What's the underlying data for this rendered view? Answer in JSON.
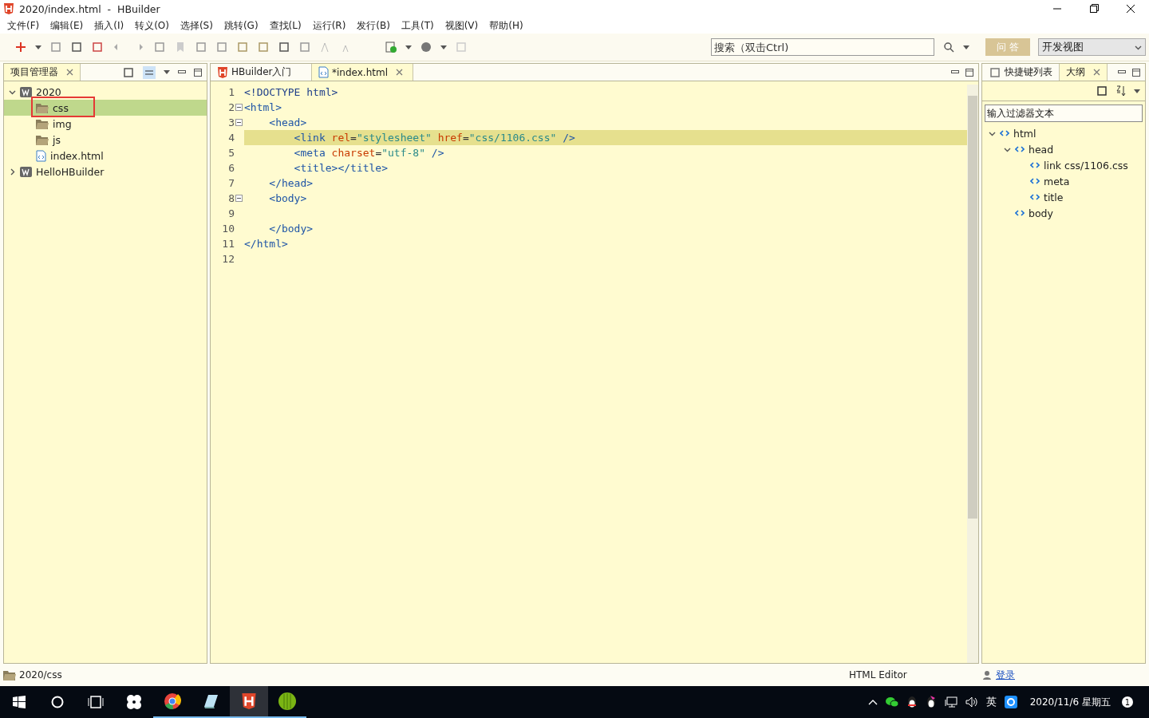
{
  "window": {
    "title": "2020/index.html  -  HBuilder"
  },
  "menu": [
    "文件(F)",
    "编辑(E)",
    "插入(I)",
    "转义(O)",
    "选择(S)",
    "跳转(G)",
    "查找(L)",
    "运行(R)",
    "发行(B)",
    "工具(T)",
    "视图(V)",
    "帮助(H)"
  ],
  "toolbar": {
    "search": {
      "placeholder": "搜索（双击Ctrl)"
    },
    "qa_button": "问 答",
    "perspective": "开发视图"
  },
  "project_panel": {
    "tab": "项目管理器",
    "tree": [
      {
        "label": "2020",
        "kind": "project",
        "expanded": true,
        "selected": false,
        "children": [
          {
            "label": "css",
            "kind": "folder",
            "selected": true
          },
          {
            "label": "img",
            "kind": "folder",
            "selected": false
          },
          {
            "label": "js",
            "kind": "folder",
            "selected": false
          },
          {
            "label": "index.html",
            "kind": "file",
            "selected": false
          }
        ]
      },
      {
        "label": "HelloHBuilder",
        "kind": "project",
        "expanded": false,
        "selected": false
      }
    ]
  },
  "editor": {
    "tabs": [
      {
        "label": "HBuilder入门",
        "kind": "app",
        "selected": false
      },
      {
        "label": "*index.html",
        "kind": "file",
        "selected": true
      }
    ],
    "lines": [
      {
        "number": "1",
        "fold": false,
        "current": false,
        "tokens": [
          {
            "kind": "doctype",
            "text": "<!DOCTYPE html>"
          }
        ]
      },
      {
        "number": "2",
        "fold": true,
        "current": false,
        "tokens": [
          {
            "kind": "tag",
            "text": "<html>"
          }
        ]
      },
      {
        "number": "3",
        "fold": true,
        "current": false,
        "tokens": [
          {
            "kind": "tag",
            "text": "    <head>"
          }
        ]
      },
      {
        "number": "4",
        "fold": false,
        "current": true,
        "tokens": [
          {
            "kind": "tag",
            "text": "        <link "
          },
          {
            "kind": "attr",
            "text": "rel"
          },
          {
            "kind": "plain",
            "text": "="
          },
          {
            "kind": "string",
            "text": "\"stylesheet\" "
          },
          {
            "kind": "attr",
            "text": "href"
          },
          {
            "kind": "plain",
            "text": "="
          },
          {
            "kind": "string",
            "text": "\"css/1106.css\" "
          },
          {
            "kind": "tag",
            "text": "/>"
          }
        ]
      },
      {
        "number": "5",
        "fold": false,
        "current": false,
        "tokens": [
          {
            "kind": "tag",
            "text": "        <meta "
          },
          {
            "kind": "attr",
            "text": "charset"
          },
          {
            "kind": "plain",
            "text": "="
          },
          {
            "kind": "string",
            "text": "\"utf-8\" "
          },
          {
            "kind": "tag",
            "text": "/>"
          }
        ]
      },
      {
        "number": "6",
        "fold": false,
        "current": false,
        "tokens": [
          {
            "kind": "tag",
            "text": "        <title></title>"
          }
        ]
      },
      {
        "number": "7",
        "fold": false,
        "current": false,
        "tokens": [
          {
            "kind": "tag",
            "text": "    </head>"
          }
        ]
      },
      {
        "number": "8",
        "fold": true,
        "current": false,
        "tokens": [
          {
            "kind": "tag",
            "text": "    <body>"
          }
        ]
      },
      {
        "number": "9",
        "fold": false,
        "current": false
      },
      {
        "number": "10",
        "fold": false,
        "current": false,
        "tokens": [
          {
            "kind": "tag",
            "text": "    </body>"
          }
        ]
      },
      {
        "number": "11",
        "fold": false,
        "current": false,
        "tokens": [
          {
            "kind": "tag",
            "text": "</html>"
          }
        ]
      },
      {
        "number": "12",
        "fold": false,
        "current": false
      }
    ]
  },
  "outline_panel": {
    "tabs": [
      {
        "label": "快捷键列表",
        "selected": false
      },
      {
        "label": "大纲",
        "selected": true
      }
    ],
    "filter": {
      "placeholder": "输入过滤器文本"
    },
    "tree": [
      {
        "label": "html",
        "expanded": true,
        "children": [
          {
            "label": "head",
            "expanded": true,
            "children": [
              {
                "label": "link css/1106.css"
              },
              {
                "label": "meta"
              },
              {
                "label": "title"
              }
            ]
          },
          {
            "label": "body"
          }
        ]
      }
    ]
  },
  "status_bar": {
    "path": "2020/css",
    "editor_type": "HTML Editor",
    "login": "登录"
  },
  "taskbar": {
    "ime": "英",
    "date": "2020/11/6 星期五",
    "notifications": "1"
  }
}
